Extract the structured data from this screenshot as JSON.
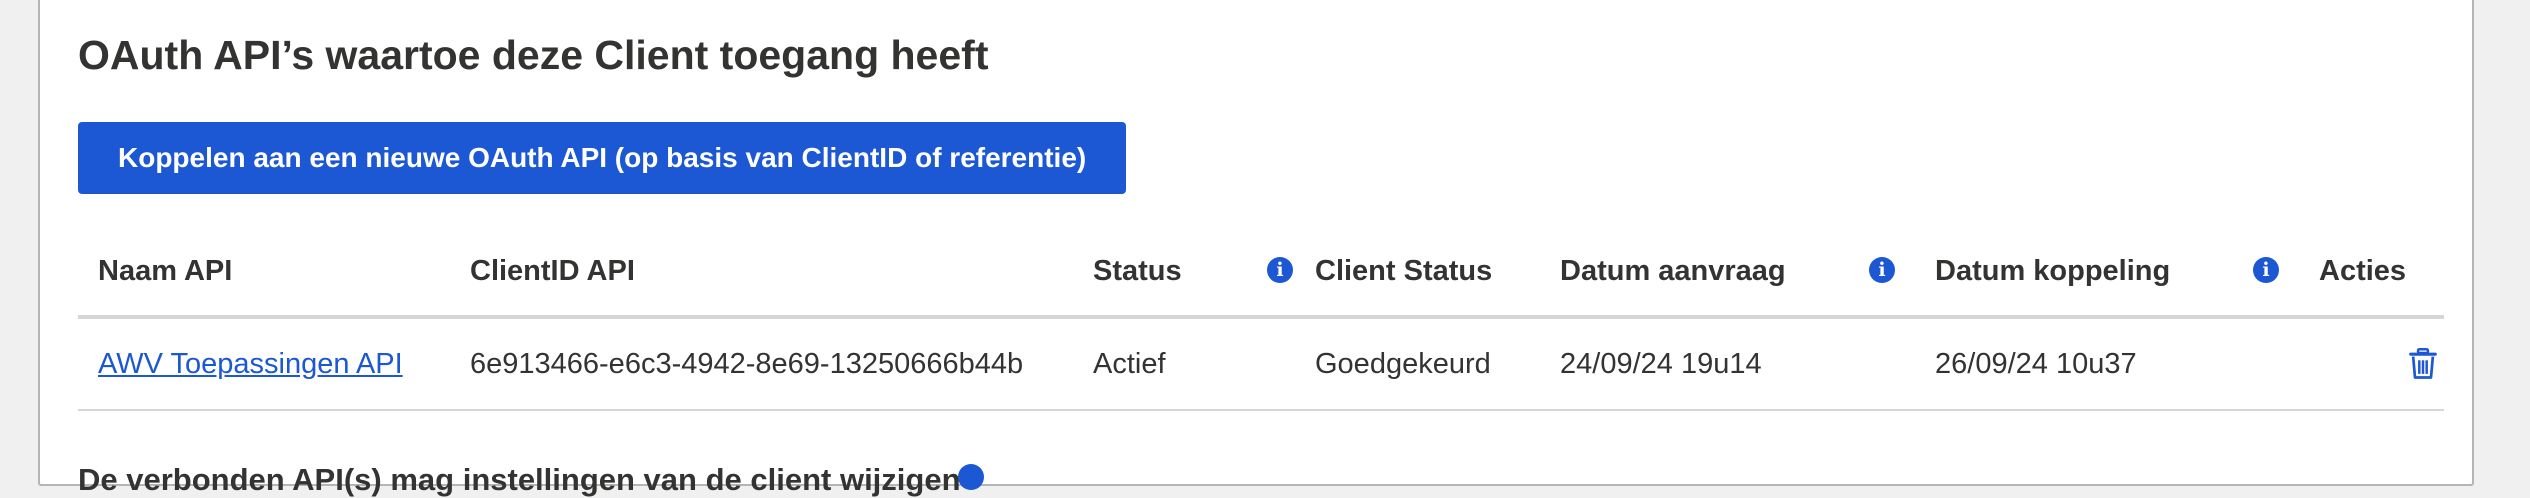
{
  "section": {
    "title": "OAuth API’s waartoe deze Client toegang heeft",
    "link_button_label": "Koppelen aan een nieuwe OAuth API (op basis van ClientID of referentie)"
  },
  "table": {
    "headers": {
      "name": "Naam API",
      "client_id": "ClientID API",
      "status": "Status",
      "client_status": "Client Status",
      "request_date": "Datum aanvraag",
      "link_date": "Datum koppeling",
      "actions": "Acties"
    },
    "rows": [
      {
        "name": "AWV Toepassingen API",
        "client_id": "6e913466-e6c3-4942-8e69-13250666b44b",
        "status": "Actief",
        "client_status": "Goedgekeurd",
        "request_date": "24/09/24 19u14",
        "link_date": "26/09/24 10u37"
      }
    ]
  },
  "footer": {
    "partial_text": "De verbonden API(s) mag instellingen van de client wijzigen"
  },
  "icons": {
    "info": "info-icon",
    "delete": "trash-icon"
  },
  "colors": {
    "accent": "#1c57d4",
    "text": "#333332",
    "border": "#d6d6d6"
  }
}
